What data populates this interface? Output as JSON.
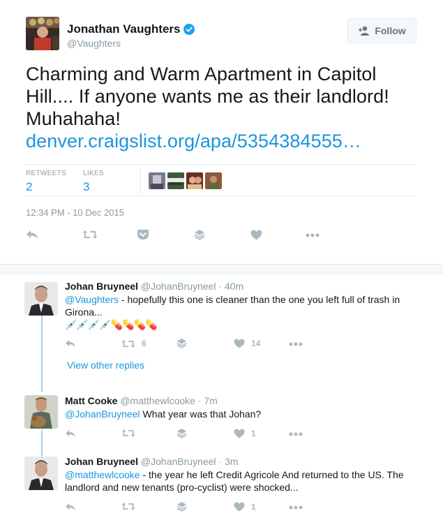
{
  "tweet": {
    "author_name": "Jonathan Vaughters",
    "author_handle": "@Vaughters",
    "follow_label": "Follow",
    "text_line": "Charming and Warm Apartment in Capitol Hill.... If anyone wants me as their landlord! Muhahaha!",
    "link_text": "denver.craigslist.org/apa/5354384555…",
    "retweets_label": "RETWEETS",
    "retweets_count": "2",
    "likes_label": "LIKES",
    "likes_count": "3",
    "timestamp": "12:34 PM - 10 Dec 2015"
  },
  "replies": [
    {
      "name": "Johan Bruyneel",
      "handle": "@JohanBruyneel",
      "time": "· 40m",
      "mention": "@Vaughters",
      "text": " - hopefully this one is cleaner than the one you left full of trash in Girona...",
      "emoji": "💉💉💉💉💊💊💊💊",
      "retweet_count": "6",
      "like_count": "14"
    },
    {
      "name": "Matt Cooke",
      "handle": "@matthewlcooke",
      "time": "· 7m",
      "mention": "@JohanBruyneel",
      "text": " What year was that Johan?",
      "retweet_count": "",
      "like_count": "1"
    },
    {
      "name": "Johan Bruyneel",
      "handle": "@JohanBruyneel",
      "time": "· 3m",
      "mention": "@matthewlcooke",
      "text": " - the year he left Credit Agricole And returned to the US. The landlord and new tenants (pro-cyclist) were shocked...",
      "retweet_count": "",
      "like_count": "1"
    }
  ],
  "view_other_replies": "View other replies",
  "colors": {
    "link": "#1b95e0",
    "muted": "#8899a6",
    "icon": "#aab8c2",
    "thread_line": "#a0cfee"
  }
}
